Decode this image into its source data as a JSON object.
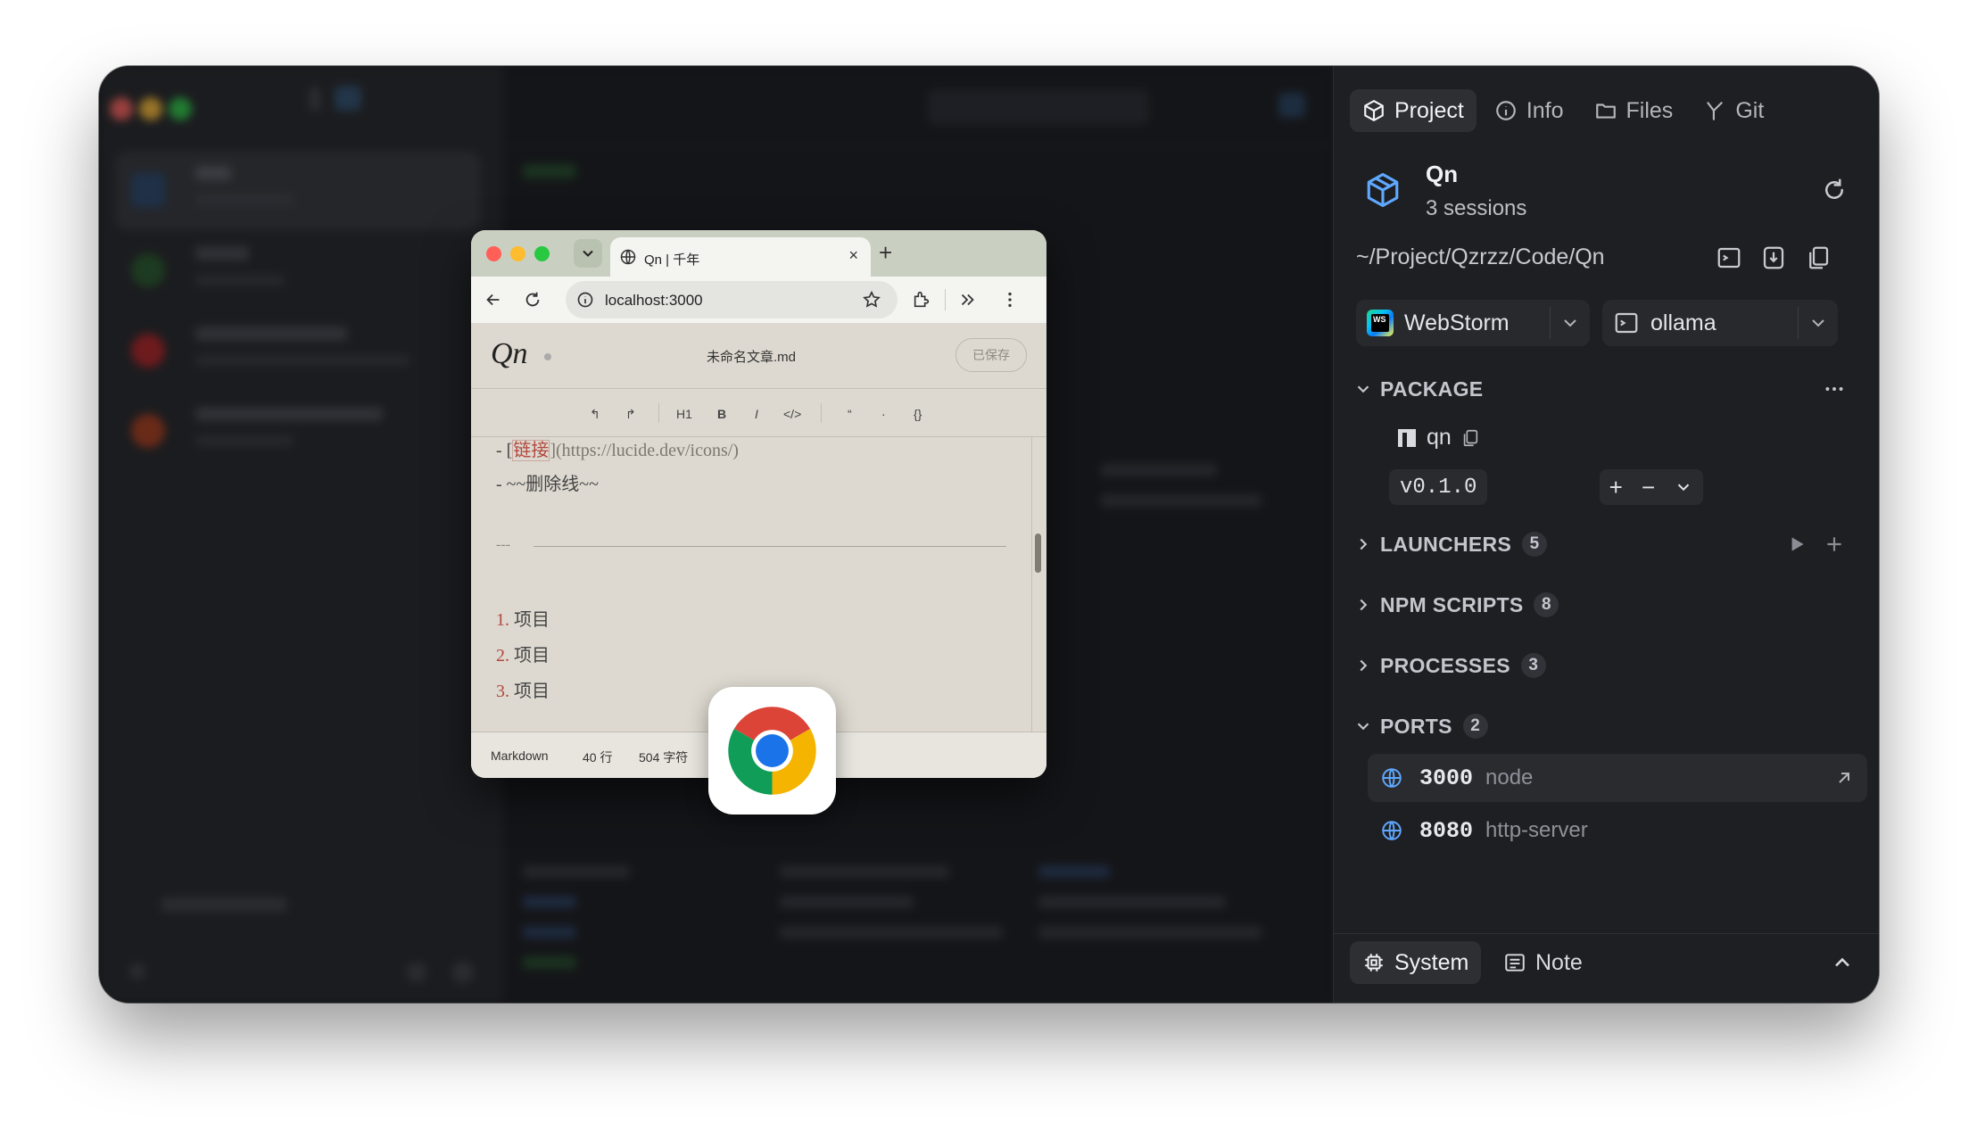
{
  "panel": {
    "tabs": [
      {
        "label": "Project",
        "icon": "cube-icon"
      },
      {
        "label": "Info",
        "icon": "info-icon"
      },
      {
        "label": "Files",
        "icon": "folder-icon"
      },
      {
        "label": "Git",
        "icon": "git-branch-icon"
      }
    ],
    "project": {
      "name": "Qn",
      "sessions": "3 sessions",
      "path": "~/Project/Qzrzz/Code/Qn"
    },
    "ide_select": {
      "label": "WebStorm",
      "logo_text": "WS"
    },
    "ai_select": {
      "label": "ollama"
    },
    "package": {
      "header": "PACKAGE",
      "name": "qn",
      "version": "v0.1.0",
      "plus": "+",
      "minus": "−"
    },
    "sections": {
      "launchers": {
        "label": "LAUNCHERS",
        "count": "5"
      },
      "npm_scripts": {
        "label": "NPM SCRIPTS",
        "count": "8"
      },
      "processes": {
        "label": "PROCESSES",
        "count": "3"
      },
      "ports": {
        "label": "PORTS",
        "count": "2"
      }
    },
    "ports": [
      {
        "port": "3000",
        "process": "node"
      },
      {
        "port": "8080",
        "process": "http-server"
      }
    ],
    "bottom_tabs": {
      "system": "System",
      "note": "Note"
    }
  },
  "chrome": {
    "tab_title": "Qn | 千年",
    "new_tab": "+",
    "close_tab": "×",
    "url": "localhost:3000",
    "editor": {
      "logo": "Qn",
      "filename": "未命名文章.md",
      "save_status": "已保存",
      "toolbar": [
        "↰",
        "↱",
        "H1",
        "B",
        "I",
        "</>",
        "“",
        "·",
        "{}"
      ],
      "lines": {
        "link_prefix": "- [",
        "link_text": "链接",
        "link_suffix": "](https://lucide.dev/icons/)",
        "strike": "- ~~删除线~~",
        "hr": "---",
        "ol": [
          {
            "n": "1.",
            "text": "项目"
          },
          {
            "n": "2.",
            "text": "项目"
          },
          {
            "n": "3.",
            "text": "项目"
          }
        ]
      },
      "status": {
        "mode": "Markdown",
        "lines": "40 行",
        "chars": "504 字符"
      }
    }
  },
  "colors": {
    "panel_bg": "#1e1f22",
    "accent_blue": "#5fa8ff",
    "editor_bg": "#ddd9d0",
    "link_red": "#b2473e"
  }
}
